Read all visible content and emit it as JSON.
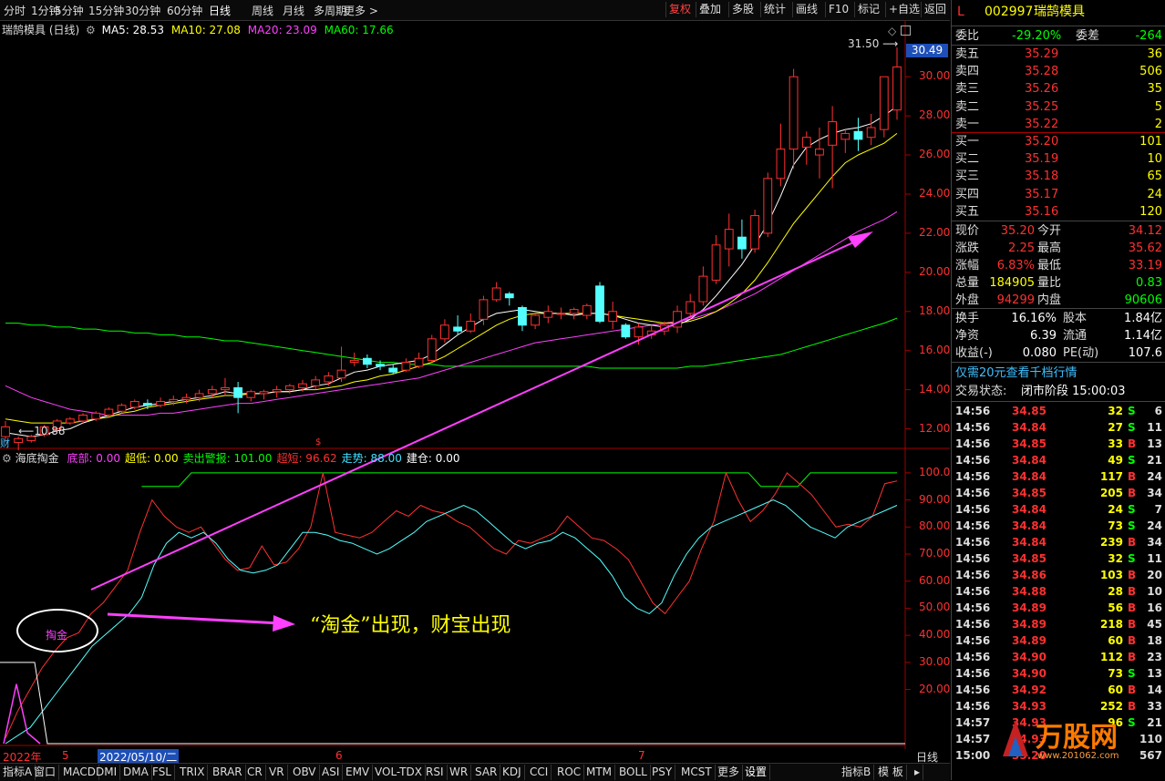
{
  "toolbar": {
    "periods": [
      "分时",
      "1分钟",
      "5分钟",
      "15分钟",
      "30分钟",
      "60分钟",
      "日线",
      "周线",
      "月线",
      "多周期",
      "更多 >"
    ],
    "right_buttons": [
      "复权",
      "叠加",
      "多股",
      "统计",
      "画线",
      "F10",
      "标记",
      "+自选",
      "返回"
    ]
  },
  "header": {
    "name": "瑞鹄模具 (日线)",
    "ma5": "MA5: 28.53",
    "ma10": "MA10: 27.08",
    "ma20": "MA20: 23.09",
    "ma60": "MA60: 17.66"
  },
  "annotations": {
    "high_label": "31.50",
    "low_label": "10.88",
    "last_price_tag": "30.49",
    "ellipse_text": "掏金",
    "callout": "“淘金”出现，财宝出现",
    "cai_mark": "财"
  },
  "indicator": {
    "name": "海底掏金",
    "items": [
      {
        "text": "底部: 0.00",
        "color": "#ff40ff"
      },
      {
        "text": "超低: 0.00",
        "color": "#ffff00"
      },
      {
        "text": "卖出警报: 101.00",
        "color": "#00ff00"
      },
      {
        "text": "超短: 96.62",
        "color": "#ff3030"
      },
      {
        "text": "走势: 88.00",
        "color": "#40e0ff"
      },
      {
        "text": "建仓: 0.00",
        "color": "#ffffff"
      }
    ]
  },
  "price_axis": [
    "30.00",
    "28.00",
    "26.00",
    "24.00",
    "22.00",
    "20.00",
    "18.00",
    "16.00",
    "14.00",
    "12.00"
  ],
  "ind_axis": [
    "100.0",
    "90.00",
    "80.00",
    "70.00",
    "60.00",
    "50.00",
    "40.00",
    "30.00",
    "20.00"
  ],
  "date_axis": {
    "year": "2022年",
    "m5": "5",
    "cursor_date": "2022/05/10/二",
    "m6": "6",
    "m7": "7",
    "period": "日线"
  },
  "bottom_tabs": [
    "指标A",
    "窗口",
    "MACD",
    "DMI",
    "DMA",
    "FSL",
    "TRIX",
    "BRAR",
    "CR",
    "VR",
    "OBV",
    "ASI",
    "EMV",
    "VOL-TDX",
    "RSI",
    "WR",
    "SAR",
    "KDJ",
    "CCI",
    "ROC",
    "MTM",
    "BOLL",
    "PSY",
    "MCST",
    "更多",
    "设置"
  ],
  "bottom_right_tabs": [
    "指标B",
    "模 板"
  ],
  "stock": {
    "flag": "L",
    "code": "002997",
    "name": "瑞鹄模具",
    "weibi_label": "委比",
    "weibi_value": "-29.20%",
    "weicha_label": "委差",
    "weicha_value": "-264",
    "sell": [
      {
        "label": "卖五",
        "price": "35.29",
        "vol": "36"
      },
      {
        "label": "卖四",
        "price": "35.28",
        "vol": "506"
      },
      {
        "label": "卖三",
        "price": "35.26",
        "vol": "35"
      },
      {
        "label": "卖二",
        "price": "35.25",
        "vol": "5"
      },
      {
        "label": "卖一",
        "price": "35.22",
        "vol": "2"
      }
    ],
    "buy": [
      {
        "label": "买一",
        "price": "35.20",
        "vol": "101"
      },
      {
        "label": "买二",
        "price": "35.19",
        "vol": "10"
      },
      {
        "label": "买三",
        "price": "35.18",
        "vol": "65"
      },
      {
        "label": "买四",
        "price": "35.17",
        "vol": "24"
      },
      {
        "label": "买五",
        "price": "35.16",
        "vol": "120"
      }
    ],
    "quote": [
      {
        "l1": "现价",
        "v1": "35.20",
        "c1": "#ff3030",
        "l2": "今开",
        "v2": "34.12",
        "c2": "#ff3030"
      },
      {
        "l1": "涨跌",
        "v1": "2.25",
        "c1": "#ff3030",
        "l2": "最高",
        "v2": "35.62",
        "c2": "#ff3030"
      },
      {
        "l1": "涨幅",
        "v1": "6.83%",
        "c1": "#ff3030",
        "l2": "最低",
        "v2": "33.19",
        "c2": "#ff3030"
      },
      {
        "l1": "总量",
        "v1": "184905",
        "c1": "#ffff00",
        "l2": "量比",
        "v2": "0.83",
        "c2": "#00ff00"
      },
      {
        "l1": "外盘",
        "v1": "94299",
        "c1": "#ff3030",
        "l2": "内盘",
        "v2": "90606",
        "c2": "#00ff00"
      }
    ],
    "info": [
      {
        "l1": "换手",
        "v1": "16.16%",
        "l2": "股本",
        "v2": "1.84亿"
      },
      {
        "l1": "净资",
        "v1": "6.39",
        "l2": "流通",
        "v2": "1.14亿"
      },
      {
        "l1": "收益(-)",
        "v1": "0.080",
        "l2": "PE(动)",
        "v2": "107.6"
      }
    ],
    "promo": "仅需20元查看千档行情",
    "status_label": "交易状态:",
    "status_value": "闭市阶段 15:00:03"
  },
  "ticks": [
    {
      "t": "14:56",
      "p": "34.85",
      "v": "32",
      "d": "S",
      "n": "6"
    },
    {
      "t": "14:56",
      "p": "34.84",
      "v": "27",
      "d": "S",
      "n": "11"
    },
    {
      "t": "14:56",
      "p": "34.85",
      "v": "33",
      "d": "B",
      "n": "13"
    },
    {
      "t": "14:56",
      "p": "34.84",
      "v": "49",
      "d": "S",
      "n": "21"
    },
    {
      "t": "14:56",
      "p": "34.84",
      "v": "117",
      "d": "B",
      "n": "24"
    },
    {
      "t": "14:56",
      "p": "34.85",
      "v": "205",
      "d": "B",
      "n": "34"
    },
    {
      "t": "14:56",
      "p": "34.84",
      "v": "24",
      "d": "S",
      "n": "7"
    },
    {
      "t": "14:56",
      "p": "34.84",
      "v": "73",
      "d": "S",
      "n": "24"
    },
    {
      "t": "14:56",
      "p": "34.84",
      "v": "239",
      "d": "B",
      "n": "34"
    },
    {
      "t": "14:56",
      "p": "34.85",
      "v": "32",
      "d": "S",
      "n": "11"
    },
    {
      "t": "14:56",
      "p": "34.86",
      "v": "103",
      "d": "B",
      "n": "20"
    },
    {
      "t": "14:56",
      "p": "34.88",
      "v": "28",
      "d": "B",
      "n": "10"
    },
    {
      "t": "14:56",
      "p": "34.89",
      "v": "56",
      "d": "B",
      "n": "16"
    },
    {
      "t": "14:56",
      "p": "34.89",
      "v": "218",
      "d": "B",
      "n": "45"
    },
    {
      "t": "14:56",
      "p": "34.89",
      "v": "60",
      "d": "B",
      "n": "18"
    },
    {
      "t": "14:56",
      "p": "34.90",
      "v": "112",
      "d": "B",
      "n": "23"
    },
    {
      "t": "14:56",
      "p": "34.90",
      "v": "73",
      "d": "S",
      "n": "13"
    },
    {
      "t": "14:56",
      "p": "34.92",
      "v": "60",
      "d": "B",
      "n": "14"
    },
    {
      "t": "14:56",
      "p": "34.93",
      "v": "252",
      "d": "B",
      "n": "33"
    },
    {
      "t": "14:57",
      "p": "34.93",
      "v": "96",
      "d": "S",
      "n": "21"
    },
    {
      "t": "14:57",
      "p": "34.93",
      "v": "",
      "d": "",
      "n": "110"
    },
    {
      "t": "15:00",
      "p": "35.20",
      "v": "",
      "d": "",
      "n": "567"
    }
  ],
  "watermark": {
    "brand": "万股网",
    "url": "www.201062.com"
  },
  "colors": {
    "up": "#ff3030",
    "down": "#54ffff",
    "ma5": "#ffffff",
    "ma10": "#ffff00",
    "ma20": "#ff40ff",
    "ma60": "#00ff00",
    "accent": "#ff40ff"
  },
  "chart_data": {
    "type": "candlestick",
    "price_range": [
      11.0,
      31.5
    ],
    "candles": [
      [
        11.6,
        12.1,
        11.3,
        12.4
      ],
      [
        11.3,
        11.5,
        10.9,
        11.6
      ],
      [
        11.4,
        11.6,
        11.3,
        11.7
      ],
      [
        11.7,
        12.1,
        11.6,
        12.2
      ],
      [
        12.0,
        12.4,
        11.9,
        12.5
      ],
      [
        12.3,
        12.5,
        12.2,
        12.6
      ],
      [
        12.4,
        12.7,
        12.3,
        12.8
      ],
      [
        12.5,
        12.8,
        12.4,
        12.9
      ],
      [
        12.7,
        13.0,
        12.6,
        13.1
      ],
      [
        12.9,
        13.2,
        12.8,
        13.3
      ],
      [
        13.1,
        13.4,
        13.0,
        13.5
      ],
      [
        13.3,
        13.2,
        13.0,
        13.5
      ],
      [
        13.2,
        13.4,
        13.1,
        13.6
      ],
      [
        13.4,
        13.5,
        13.2,
        13.7
      ],
      [
        13.5,
        13.6,
        13.3,
        13.8
      ],
      [
        13.6,
        13.8,
        13.4,
        14.0
      ],
      [
        13.8,
        14.0,
        13.6,
        14.2
      ],
      [
        14.0,
        14.1,
        13.7,
        14.6
      ],
      [
        14.1,
        13.6,
        12.8,
        14.4
      ],
      [
        13.6,
        13.9,
        13.4,
        14.0
      ],
      [
        13.8,
        13.9,
        13.5,
        14.0
      ],
      [
        13.9,
        14.0,
        13.6,
        14.2
      ],
      [
        14.0,
        14.2,
        13.8,
        14.3
      ],
      [
        14.1,
        14.3,
        13.9,
        14.5
      ],
      [
        14.2,
        14.5,
        14.0,
        14.7
      ],
      [
        14.4,
        14.7,
        14.2,
        14.9
      ],
      [
        14.6,
        15.0,
        14.4,
        16.2
      ],
      [
        15.4,
        15.5,
        15.2,
        15.9
      ],
      [
        15.6,
        15.3,
        15.1,
        15.8
      ],
      [
        15.3,
        15.2,
        15.0,
        15.5
      ],
      [
        15.1,
        14.9,
        14.8,
        15.3
      ],
      [
        15.0,
        15.4,
        14.9,
        15.6
      ],
      [
        15.2,
        15.6,
        15.1,
        15.9
      ],
      [
        15.5,
        16.6,
        15.4,
        16.8
      ],
      [
        16.6,
        17.3,
        16.4,
        17.6
      ],
      [
        17.2,
        17.0,
        16.8,
        17.8
      ],
      [
        17.0,
        17.5,
        16.9,
        17.9
      ],
      [
        17.6,
        18.6,
        17.3,
        18.8
      ],
      [
        18.6,
        19.2,
        18.5,
        19.5
      ],
      [
        18.9,
        18.7,
        18.3,
        19.0
      ],
      [
        18.2,
        17.3,
        17.0,
        18.3
      ],
      [
        17.3,
        17.8,
        17.1,
        17.9
      ],
      [
        17.7,
        18.0,
        17.4,
        18.3
      ],
      [
        17.9,
        17.9,
        17.6,
        18.2
      ],
      [
        17.9,
        18.1,
        17.6,
        18.2
      ],
      [
        17.8,
        18.3,
        17.6,
        18.4
      ],
      [
        19.3,
        17.5,
        17.4,
        19.5
      ],
      [
        17.5,
        18.0,
        17.1,
        18.5
      ],
      [
        17.3,
        16.7,
        16.6,
        17.4
      ],
      [
        16.7,
        17.2,
        16.3,
        17.4
      ],
      [
        16.8,
        17.0,
        16.6,
        17.3
      ],
      [
        17.0,
        17.3,
        16.8,
        17.5
      ],
      [
        17.2,
        18.0,
        16.9,
        18.3
      ],
      [
        17.9,
        18.5,
        17.6,
        18.9
      ],
      [
        18.5,
        19.8,
        18.3,
        20.3
      ],
      [
        19.6,
        21.4,
        19.4,
        21.9
      ],
      [
        21.2,
        22.2,
        20.3,
        23.0
      ],
      [
        21.8,
        21.2,
        20.7,
        22.7
      ],
      [
        21.2,
        22.9,
        21.0,
        23.2
      ],
      [
        22.0,
        24.8,
        21.8,
        25.1
      ],
      [
        24.8,
        26.3,
        24.4,
        27.6
      ],
      [
        26.3,
        30.0,
        25.3,
        30.4
      ],
      [
        26.4,
        26.9,
        25.5,
        27.2
      ],
      [
        26.0,
        26.3,
        24.8,
        27.4
      ],
      [
        26.5,
        27.7,
        24.3,
        28.5
      ],
      [
        26.8,
        27.1,
        26.1,
        27.3
      ],
      [
        27.2,
        26.8,
        26.2,
        27.9
      ],
      [
        26.9,
        27.4,
        26.5,
        28.1
      ],
      [
        27.3,
        30.0,
        26.9,
        30.0
      ],
      [
        28.3,
        30.5,
        27.8,
        31.5
      ]
    ],
    "ma5": [
      11.8,
      11.7,
      11.6,
      11.7,
      11.9,
      12.0,
      12.3,
      12.5,
      12.7,
      12.9,
      13.1,
      13.2,
      13.3,
      13.4,
      13.5,
      13.6,
      13.7,
      13.9,
      13.8,
      13.8,
      13.8,
      13.9,
      13.9,
      14.0,
      14.2,
      14.3,
      14.6,
      14.9,
      15.0,
      15.2,
      15.3,
      15.4,
      15.5,
      15.8,
      16.3,
      16.8,
      17.2,
      17.6,
      17.9,
      18.0,
      18.1,
      18.0,
      17.9,
      17.9,
      17.8,
      17.9,
      17.9,
      17.8,
      17.6,
      17.4,
      17.3,
      17.2,
      17.3,
      17.6,
      18.1,
      18.8,
      19.6,
      20.4,
      21.4,
      22.5,
      23.9,
      25.5,
      26.4,
      26.8,
      27.1,
      27.3,
      27.4,
      27.6,
      28.0,
      28.5
    ],
    "ma10": [
      12.5,
      12.4,
      12.3,
      12.3,
      12.3,
      12.3,
      12.4,
      12.5,
      12.6,
      12.8,
      12.9,
      13.1,
      13.2,
      13.3,
      13.4,
      13.5,
      13.6,
      13.7,
      13.7,
      13.8,
      13.8,
      13.9,
      13.9,
      14.0,
      14.0,
      14.1,
      14.2,
      14.4,
      14.5,
      14.7,
      14.8,
      15.0,
      15.2,
      15.4,
      15.7,
      16.1,
      16.5,
      16.9,
      17.3,
      17.6,
      17.8,
      17.9,
      17.9,
      17.9,
      17.9,
      17.9,
      17.9,
      17.8,
      17.7,
      17.6,
      17.5,
      17.4,
      17.4,
      17.5,
      17.7,
      18.0,
      18.4,
      18.9,
      19.6,
      20.5,
      21.5,
      22.5,
      23.3,
      24.1,
      24.9,
      25.6,
      26.0,
      26.3,
      26.6,
      27.1
    ],
    "ma20": [
      14.2,
      13.9,
      13.6,
      13.4,
      13.2,
      13.0,
      12.9,
      12.8,
      12.7,
      12.7,
      12.7,
      12.7,
      12.8,
      12.8,
      12.9,
      13.0,
      13.1,
      13.2,
      13.3,
      13.3,
      13.4,
      13.5,
      13.6,
      13.7,
      13.8,
      13.9,
      14.0,
      14.1,
      14.2,
      14.3,
      14.4,
      14.5,
      14.6,
      14.8,
      15.0,
      15.2,
      15.4,
      15.6,
      15.8,
      16.0,
      16.2,
      16.4,
      16.5,
      16.6,
      16.7,
      16.8,
      16.9,
      17.0,
      17.1,
      17.2,
      17.3,
      17.4,
      17.5,
      17.6,
      17.8,
      18.0,
      18.3,
      18.6,
      18.9,
      19.3,
      19.7,
      20.1,
      20.5,
      20.9,
      21.3,
      21.7,
      22.1,
      22.4,
      22.7,
      23.1
    ],
    "ma60": [
      17.4,
      17.4,
      17.3,
      17.3,
      17.2,
      17.2,
      17.1,
      17.1,
      17.0,
      17.0,
      16.9,
      16.9,
      16.8,
      16.8,
      16.7,
      16.7,
      16.6,
      16.5,
      16.5,
      16.4,
      16.3,
      16.2,
      16.1,
      16.0,
      15.9,
      15.8,
      15.7,
      15.6,
      15.5,
      15.4,
      15.4,
      15.3,
      15.3,
      15.3,
      15.2,
      15.2,
      15.2,
      15.2,
      15.2,
      15.2,
      15.2,
      15.2,
      15.2,
      15.2,
      15.2,
      15.2,
      15.1,
      15.1,
      15.1,
      15.1,
      15.1,
      15.1,
      15.1,
      15.2,
      15.2,
      15.3,
      15.4,
      15.5,
      15.6,
      15.7,
      15.8,
      16.0,
      16.2,
      16.4,
      16.6,
      16.8,
      17.0,
      17.2,
      17.4,
      17.66
    ],
    "ind_range": [
      0,
      105
    ],
    "red_series": [
      2,
      12,
      20,
      28,
      34,
      39,
      41,
      48,
      52,
      58,
      64,
      78,
      90,
      84,
      80,
      78,
      80,
      74,
      68,
      64,
      65,
      73,
      66,
      67,
      72,
      80,
      100,
      78,
      77,
      76,
      78,
      82,
      86,
      84,
      88,
      86,
      85,
      82,
      80,
      76,
      72,
      70,
      75,
      74,
      76,
      78,
      84,
      80,
      76,
      75,
      72,
      68,
      60,
      52,
      48,
      54,
      60,
      72,
      82,
      100,
      90,
      82,
      86,
      92,
      100,
      96,
      92,
      86,
      80,
      81,
      80,
      84,
      96,
      97
    ],
    "cyan_series": [
      0,
      3,
      6,
      12,
      18,
      24,
      30,
      36,
      40,
      44,
      48,
      54,
      66,
      74,
      78,
      76,
      78,
      74,
      68,
      64,
      63,
      64,
      66,
      72,
      78,
      78,
      77,
      75,
      74,
      72,
      70,
      72,
      75,
      78,
      82,
      84,
      86,
      88,
      86,
      82,
      78,
      74,
      72,
      74,
      75,
      78,
      76,
      72,
      68,
      62,
      54,
      50,
      48,
      52,
      62,
      70,
      76,
      80,
      82,
      84,
      86,
      88,
      90,
      88,
      84,
      80,
      78,
      76,
      80,
      82,
      84,
      86,
      88
    ],
    "sell_alarm": [
      100,
      100,
      100,
      100,
      100,
      100,
      100,
      100,
      100,
      100,
      100,
      95,
      95,
      95,
      95,
      100,
      100,
      100,
      100,
      100,
      100,
      100,
      100,
      100,
      100,
      100,
      100,
      100,
      100,
      100,
      100,
      100,
      100,
      100,
      100,
      100,
      100,
      100,
      100,
      100,
      100,
      100,
      100,
      100,
      100,
      100,
      100,
      100,
      100,
      100,
      100,
      100,
      100,
      100,
      100,
      100,
      100,
      100,
      100,
      100,
      100,
      95,
      95,
      95,
      95,
      100,
      100,
      100,
      100,
      100,
      100,
      100,
      100
    ]
  }
}
